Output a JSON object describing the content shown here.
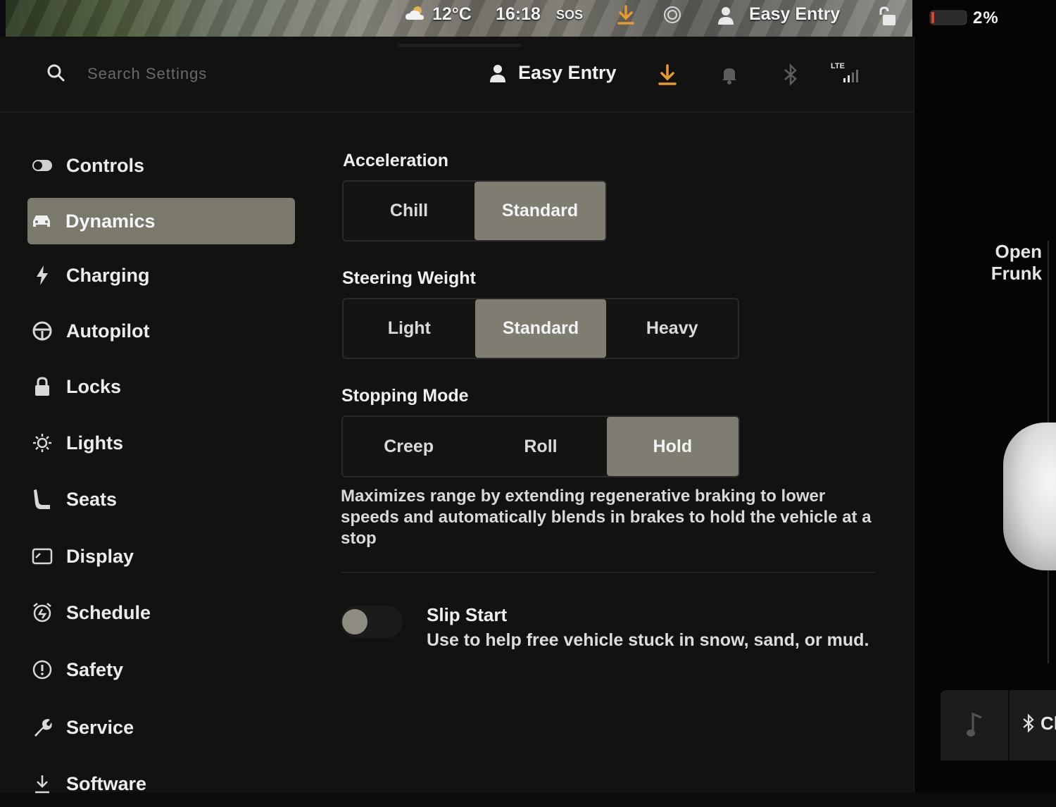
{
  "status_bar": {
    "temperature": "12°C",
    "time": "16:18",
    "sos": "SOS",
    "profile": "Easy Entry",
    "battery": "2%"
  },
  "header": {
    "search_placeholder": "Search Settings",
    "profile": "Easy Entry",
    "lte": "LTE"
  },
  "sidebar": {
    "items": [
      {
        "label": "Controls",
        "icon": "toggle-icon"
      },
      {
        "label": "Dynamics",
        "icon": "car-icon",
        "active": true
      },
      {
        "label": "Charging",
        "icon": "lightning-icon"
      },
      {
        "label": "Autopilot",
        "icon": "steering-wheel-icon"
      },
      {
        "label": "Locks",
        "icon": "lock-icon"
      },
      {
        "label": "Lights",
        "icon": "sun-icon"
      },
      {
        "label": "Seats",
        "icon": "seat-icon"
      },
      {
        "label": "Display",
        "icon": "display-icon"
      },
      {
        "label": "Schedule",
        "icon": "alarm-clock-icon"
      },
      {
        "label": "Safety",
        "icon": "alert-circle-icon"
      },
      {
        "label": "Service",
        "icon": "wrench-icon"
      },
      {
        "label": "Software",
        "icon": "download-icon"
      }
    ]
  },
  "acceleration": {
    "title": "Acceleration",
    "options": [
      "Chill",
      "Standard"
    ],
    "selected": "Standard"
  },
  "steering_weight": {
    "title": "Steering Weight",
    "options": [
      "Light",
      "Standard",
      "Heavy"
    ],
    "selected": "Standard"
  },
  "stopping_mode": {
    "title": "Stopping Mode",
    "options": [
      "Creep",
      "Roll",
      "Hold"
    ],
    "selected": "Hold",
    "description": "Maximizes range by extending regenerative braking to lower speeds and automatically blends in brakes to hold the vehicle at a stop"
  },
  "slip_start": {
    "title": "Slip Start",
    "description": "Use to help free vehicle stuck in snow, sand, or mud.",
    "enabled": false
  },
  "side_panel": {
    "open_frunk_line1": "Open",
    "open_frunk_line2": "Frunk",
    "bt_label": "Cl"
  },
  "colors": {
    "accent_orange": "#e89a2a",
    "selected_bg": "#7f7d71",
    "battery_red": "#e0402f"
  }
}
